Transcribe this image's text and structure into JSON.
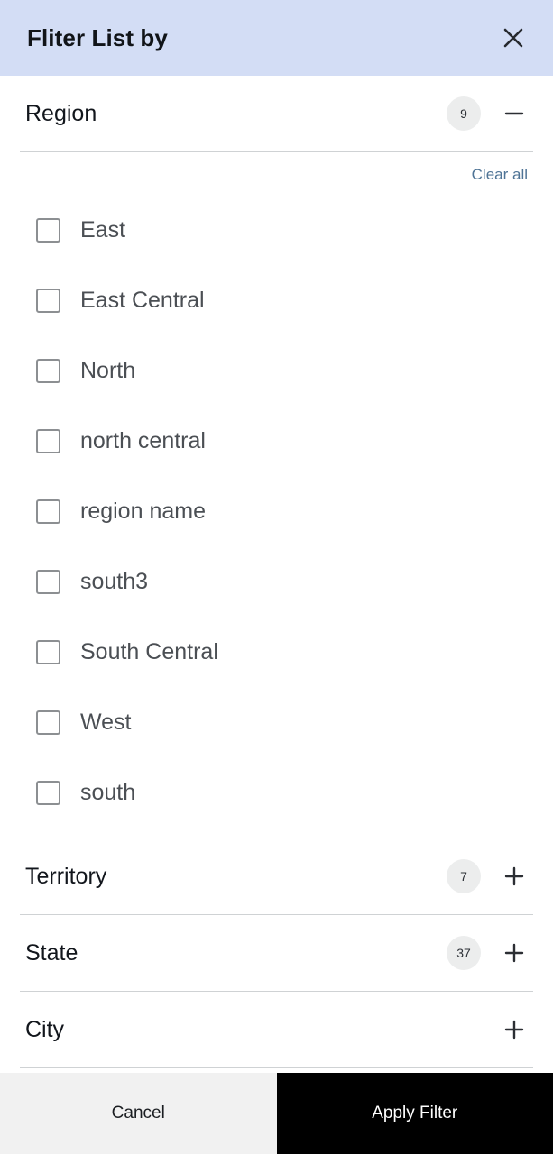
{
  "header": {
    "title": "Fliter List by",
    "close_icon": "close-icon",
    "background_color": "#d3ddf5"
  },
  "sections": [
    {
      "name": "Region",
      "count": "9",
      "expanded": true,
      "toggle_icon": "minus-icon",
      "clear_all_label": "Clear all",
      "options": [
        {
          "label": "East",
          "checked": false
        },
        {
          "label": "East Central",
          "checked": false
        },
        {
          "label": "North",
          "checked": false
        },
        {
          "label": "north central",
          "checked": false
        },
        {
          "label": "region name",
          "checked": false
        },
        {
          "label": "south3",
          "checked": false
        },
        {
          "label": "South Central",
          "checked": false
        },
        {
          "label": "West",
          "checked": false
        },
        {
          "label": "south",
          "checked": false
        }
      ]
    },
    {
      "name": "Territory",
      "count": "7",
      "expanded": false,
      "toggle_icon": "plus-icon"
    },
    {
      "name": "State",
      "count": "37",
      "expanded": false,
      "toggle_icon": "plus-icon"
    },
    {
      "name": "City",
      "count": "",
      "expanded": false,
      "toggle_icon": "plus-icon"
    }
  ],
  "footer": {
    "cancel_label": "Cancel",
    "apply_label": "Apply Filter",
    "cancel_bg": "#f1f1f1",
    "apply_bg": "#000000"
  },
  "colors": {
    "link": "#4f7496",
    "badge_bg": "#eceded",
    "divider": "#cfd2d4"
  }
}
